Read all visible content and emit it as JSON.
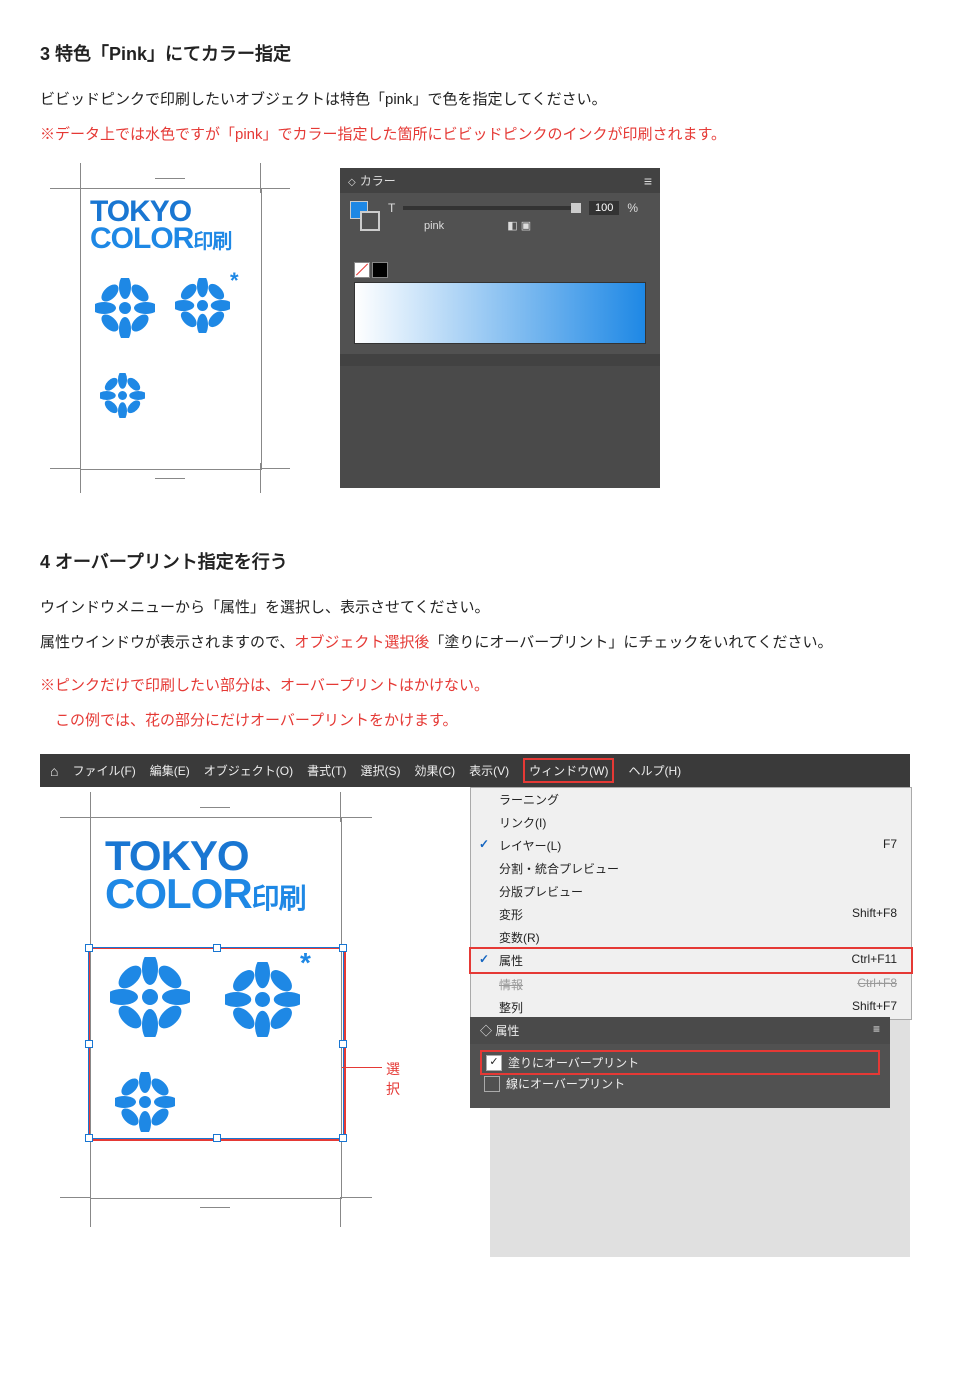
{
  "s3": {
    "heading": "3 特色「Pink」にてカラー指定",
    "p1": "ビビッドピンクで印刷したいオブジェクトは特色「pink」で色を指定してください。",
    "p2": "※データ上では水色ですが「pink」でカラー指定した箇所にビビッドピンクのインクが印刷されます。",
    "logo": {
      "l1": "TOKYO",
      "l2": "COLOR",
      "jp": "印刷"
    },
    "color_panel": {
      "title": "カラー",
      "slider_label": "T",
      "value": "100",
      "unit": "%",
      "ink_name": "pink"
    }
  },
  "s4": {
    "heading": "4 オーバープリント指定を行う",
    "p1": "ウインドウメニューから「属性」を選択し、表示させてください。",
    "p2a": "属性ウインドウが表示されますので、",
    "p2b": "オブジェクト選択後",
    "p2c": "「塗りにオーバープリント」にチェックをいれてください。",
    "note1": "※ピンクだけで印刷したい部分は、オーバープリントはかけない。",
    "note2": "　この例では、花の部分にだけオーバープリントをかけます。",
    "sel_label": "選択",
    "menubar": [
      "ファイル(F)",
      "編集(E)",
      "オブジェクト(O)",
      "書式(T)",
      "選択(S)",
      "効果(C)",
      "表示(V)",
      "ウィンドウ(W)",
      "ヘルプ(H)"
    ],
    "dropdown": [
      {
        "label": "ラーニング",
        "shortcut": ""
      },
      {
        "label": "リンク(I)",
        "shortcut": ""
      },
      {
        "label": "レイヤー(L)",
        "shortcut": "F7",
        "checked": true
      },
      {
        "label": "分割・統合プレビュー",
        "shortcut": ""
      },
      {
        "label": "分版プレビュー",
        "shortcut": ""
      },
      {
        "label": "変形",
        "shortcut": "Shift+F8"
      },
      {
        "label": "変数(R)",
        "shortcut": ""
      },
      {
        "label": "属性",
        "shortcut": "Ctrl+F11",
        "checked": true,
        "highlight": true
      },
      {
        "label": "情報",
        "shortcut": "Ctrl+F8",
        "cut": true
      },
      {
        "label": "整列",
        "shortcut": "Shift+F7"
      }
    ],
    "attr_panel": {
      "title": "属性",
      "opt1": "塗りにオーバープリント",
      "opt2": "線にオーバープリント"
    }
  }
}
